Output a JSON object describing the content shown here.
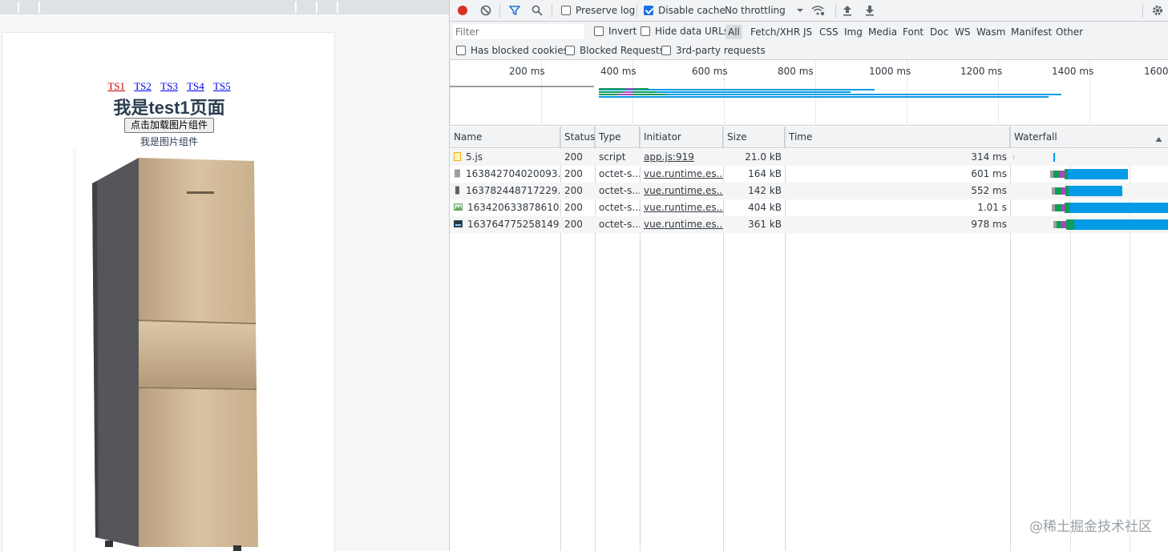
{
  "preview": {
    "nav_links": [
      "TS1",
      "TS2",
      "TS3",
      "TS4",
      "TS5"
    ],
    "heading": "我是test1页面",
    "load_button": "点击加载图片组件",
    "image_caption": "我是图片组件"
  },
  "devtools": {
    "toolbar": {
      "preserve_log": "Preserve log",
      "disable_cache": "Disable cache",
      "throttling": "No throttling"
    },
    "filter_bar": {
      "filter_placeholder": "Filter",
      "invert": "Invert",
      "hide_data_urls": "Hide data URLs",
      "types": [
        "All",
        "Fetch/XHR",
        "JS",
        "CSS",
        "Img",
        "Media",
        "Font",
        "Doc",
        "WS",
        "Wasm",
        "Manifest",
        "Other"
      ]
    },
    "options_bar": {
      "blocked_cookies": "Has blocked cookies",
      "blocked_requests": "Blocked Requests",
      "third_party": "3rd-party requests"
    },
    "overview_ticks": [
      "200 ms",
      "400 ms",
      "600 ms",
      "800 ms",
      "1000 ms",
      "1200 ms",
      "1400 ms",
      "1600"
    ],
    "columns": {
      "name": "Name",
      "status": "Status",
      "type": "Type",
      "initiator": "Initiator",
      "size": "Size",
      "time": "Time",
      "waterfall": "Waterfall"
    },
    "rows": [
      {
        "name": "5.js",
        "status": "200",
        "type": "script",
        "initiator": "app.js:919",
        "size": "21.0 kB",
        "time": "314 ms"
      },
      {
        "name": "163842704020093...",
        "status": "200",
        "type": "octet-s...",
        "initiator": "vue.runtime.es...",
        "size": "164 kB",
        "time": "601 ms"
      },
      {
        "name": "163782448717229...",
        "status": "200",
        "type": "octet-s...",
        "initiator": "vue.runtime.es...",
        "size": "142 kB",
        "time": "552 ms"
      },
      {
        "name": "163420633878610...",
        "status": "200",
        "type": "octet-s...",
        "initiator": "vue.runtime.es...",
        "size": "404 kB",
        "time": "1.01 s"
      },
      {
        "name": "163764775258149...",
        "status": "200",
        "type": "octet-s...",
        "initiator": "vue.runtime.es...",
        "size": "361 kB",
        "time": "978 ms"
      }
    ]
  },
  "watermark": "@稀土掘金技术社区"
}
